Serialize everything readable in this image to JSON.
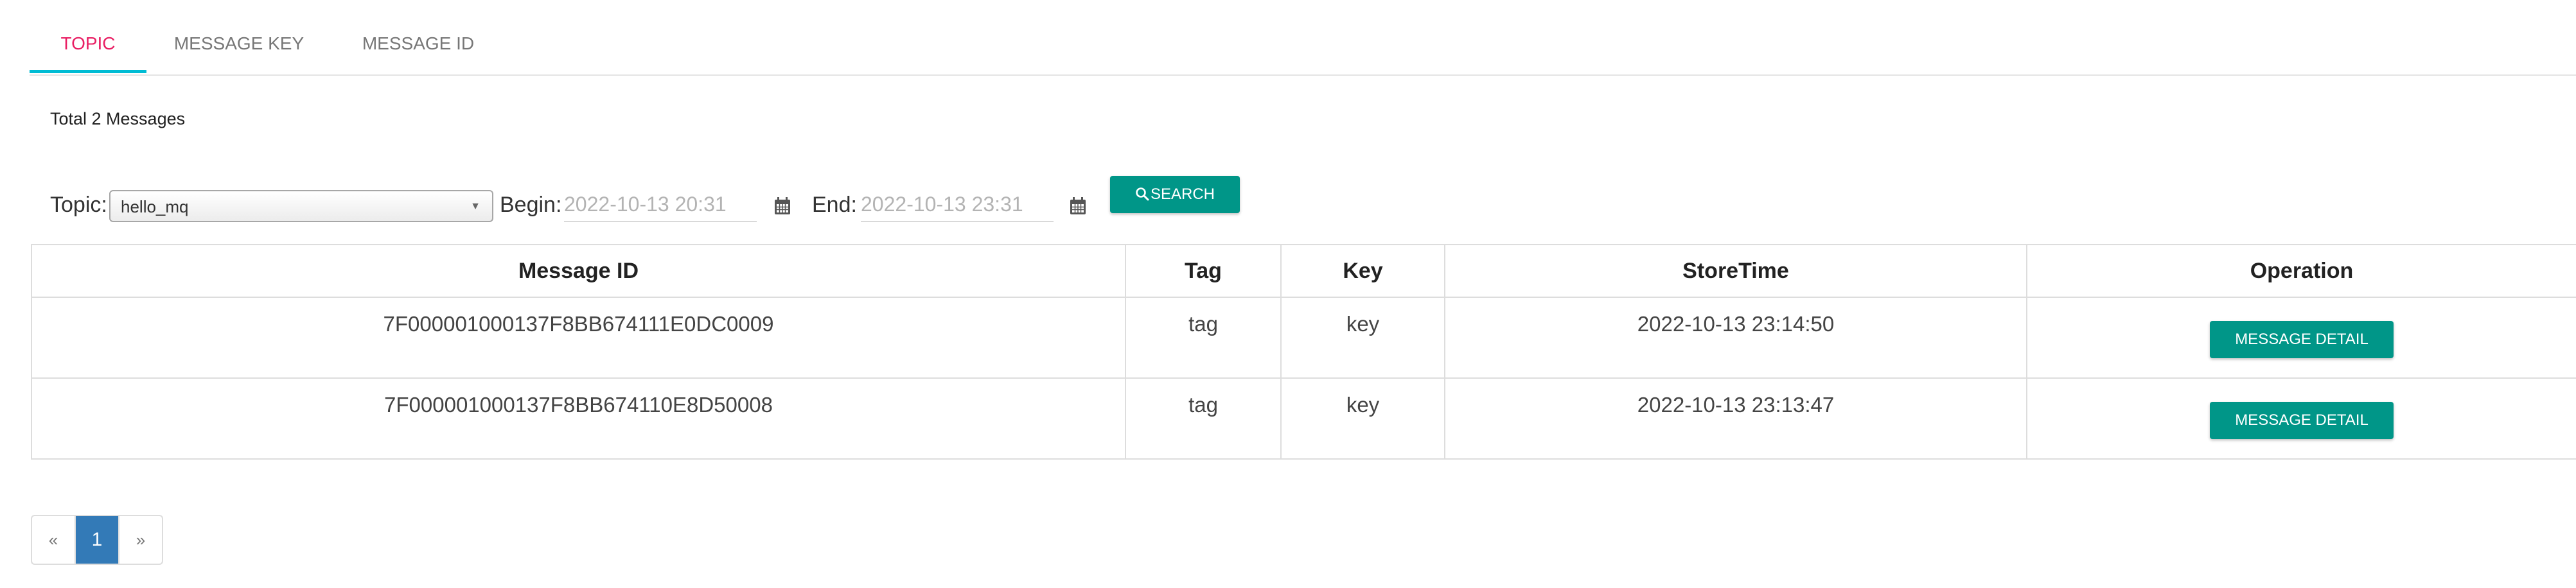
{
  "tabs": [
    {
      "label": "TOPIC",
      "active": true
    },
    {
      "label": "MESSAGE KEY",
      "active": false
    },
    {
      "label": "MESSAGE ID",
      "active": false
    }
  ],
  "total_text": "Total 2 Messages",
  "form": {
    "topic_label": "Topic:",
    "topic_value": "hello_mq",
    "begin_label": "Begin:",
    "begin_value": "2022-10-13 20:31",
    "end_label": "End:",
    "end_value": "2022-10-13 23:31",
    "search_label": "SEARCH"
  },
  "table": {
    "columns": [
      "Message ID",
      "Tag",
      "Key",
      "StoreTime",
      "Operation"
    ],
    "rows": [
      {
        "message_id": "7F000001000137F8BB674111E0DC0009",
        "tag": "tag",
        "key": "key",
        "store_time": "2022-10-13 23:14:50",
        "action": "MESSAGE DETAIL"
      },
      {
        "message_id": "7F000001000137F8BB674110E8D50008",
        "tag": "tag",
        "key": "key",
        "store_time": "2022-10-13 23:13:47",
        "action": "MESSAGE DETAIL"
      }
    ]
  },
  "pagination": {
    "prev": "«",
    "current": "1",
    "next": "»"
  },
  "colors": {
    "accent": "#009688",
    "active_tab": "#e91e63",
    "tab_underline": "#00bcd4",
    "page_active": "#337ab7"
  },
  "icons": {
    "search": "search-icon",
    "calendar": "calendar-icon",
    "dropdown": "dropdown-caret-icon"
  }
}
